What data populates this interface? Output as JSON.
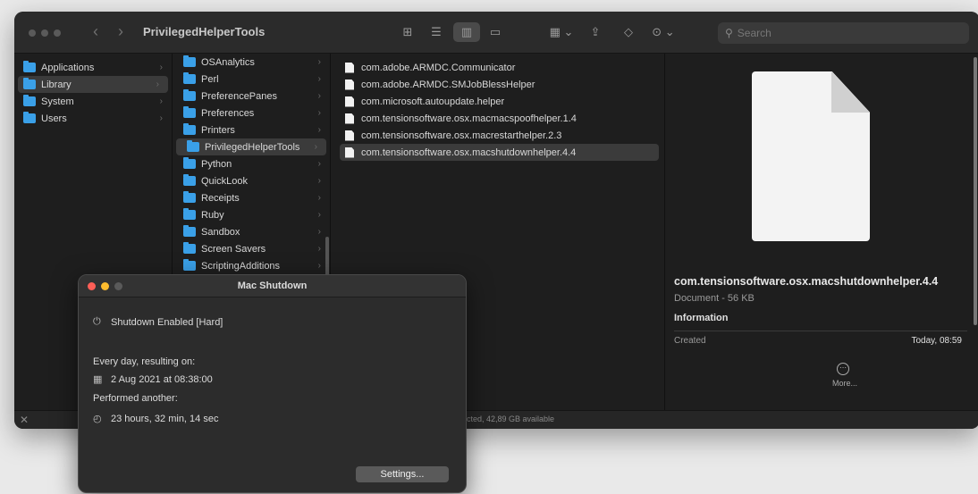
{
  "finder": {
    "title": "PrivilegedHelperTools",
    "nav": {
      "back": "‹",
      "forward": "›"
    },
    "toolbar": {
      "icon_view": "⊞",
      "list_view": "☰",
      "column_view": "▥",
      "gallery_view": "▭",
      "group": "▦ ⌄",
      "share": "⇪",
      "tag": "◇",
      "action": "⊙ ⌄"
    },
    "search_placeholder": "Search",
    "sidebar": [
      {
        "label": "Applications"
      },
      {
        "label": "Library"
      },
      {
        "label": "System"
      },
      {
        "label": "Users"
      }
    ],
    "library_items": [
      {
        "label": "OSAnalytics"
      },
      {
        "label": "Perl"
      },
      {
        "label": "PreferencePanes"
      },
      {
        "label": "Preferences"
      },
      {
        "label": "Printers"
      },
      {
        "label": "PrivilegedHelperTools"
      },
      {
        "label": "Python"
      },
      {
        "label": "QuickLook"
      },
      {
        "label": "Receipts"
      },
      {
        "label": "Ruby"
      },
      {
        "label": "Sandbox"
      },
      {
        "label": "Screen Savers"
      },
      {
        "label": "ScriptingAdditions"
      }
    ],
    "files": [
      {
        "label": "com.adobe.ARMDC.Communicator"
      },
      {
        "label": "com.adobe.ARMDC.SMJobBlessHelper"
      },
      {
        "label": "com.microsoft.autoupdate.helper"
      },
      {
        "label": "com.tensionsoftware.osx.macmacspoofhelper.1.4"
      },
      {
        "label": "com.tensionsoftware.osx.macrestarthelper.2.3"
      },
      {
        "label": "com.tensionsoftware.osx.macshutdownhelper.4.4"
      }
    ],
    "preview": {
      "name": "com.tensionsoftware.osx.macshutdownhelper.4.4",
      "kind": "Document - 56 KB",
      "info_heading": "Information",
      "created_label": "Created",
      "created_value": "Today, 08:59",
      "more_label": "More..."
    },
    "status": {
      "close": "✕",
      "text": "cted, 42,89 GB available"
    }
  },
  "dialog": {
    "title": "Mac Shutdown",
    "shutdown_status": "Shutdown Enabled  [Hard]",
    "schedule_label": "Every day, resulting on:",
    "date_value": "2 Aug 2021 at 08:38:00",
    "performed_label": "Performed another:",
    "countdown": "23 hours, 32 min, 14 sec",
    "settings_button": "Settings..."
  },
  "colors": {
    "folder_accent": "#3aa0e8",
    "close_red": "#ff5f57",
    "minimize_yellow": "#febc2e",
    "inactive_gray": "#5a5a5a"
  }
}
